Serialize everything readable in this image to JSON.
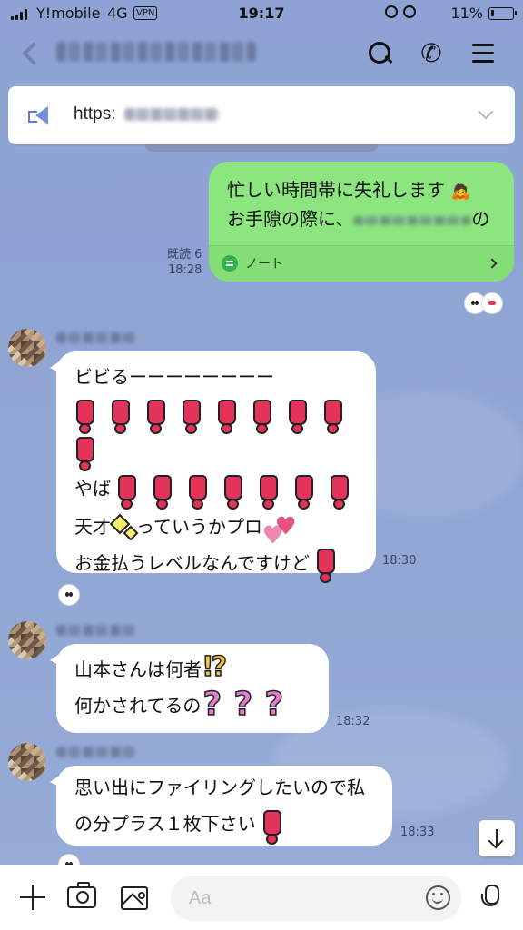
{
  "status_bar": {
    "carrier": "Y!mobile",
    "network": "4G",
    "vpn": "VPN",
    "time": "19:17",
    "battery": "11%"
  },
  "header": {
    "title": ""
  },
  "announcement": {
    "text": "https:"
  },
  "outgoing": {
    "line1": "忙しい時間帯に失礼します",
    "line2": "お手隙の際に、",
    "line2_end": "の",
    "note_label": "ノート",
    "read": "既読 6",
    "time": "18:28"
  },
  "messages": [
    {
      "lines": [
        "ビビるーーーーーーーー",
        "",
        "",
        "やば",
        "天才",
        "っていうかプロ",
        "お金払うレベルなんですけど"
      ],
      "time": "18:30"
    },
    {
      "lines": [
        "山本さんは何者",
        "何かされてるの"
      ],
      "time": "18:32"
    },
    {
      "lines": [
        "思い出にファイリングしたいので私",
        "の分プラス１枚下さい"
      ],
      "time": "18:33"
    }
  ],
  "input": {
    "placeholder": "Aa"
  },
  "colors": {
    "background": "#8fa4d2",
    "outgoing_bubble": "#8ce57e",
    "exclamation": "#e3335a"
  }
}
